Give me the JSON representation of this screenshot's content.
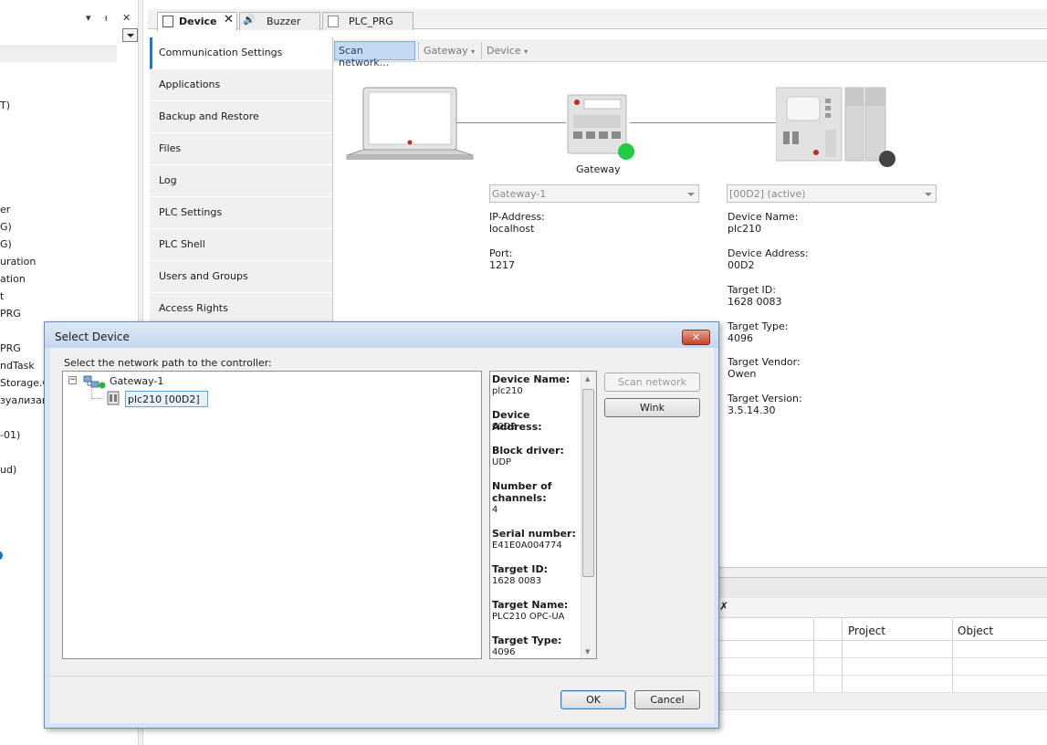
{
  "left_panel": {
    "tree_fragments": [
      "T)",
      "er",
      "G)",
      "G)",
      "uration",
      "ation",
      "t",
      "PRG",
      "PRG",
      "ndTask",
      "Storage.C",
      "зуализац",
      "-01)",
      "ud)"
    ]
  },
  "tabs": [
    {
      "label": "Device",
      "close": "✕"
    },
    {
      "label": "Buzzer"
    },
    {
      "label": "PLC_PRG"
    }
  ],
  "side_menu": {
    "items": [
      "Communication Settings",
      "Applications",
      "Backup and Restore",
      "Files",
      "Log",
      "PLC Settings",
      "PLC Shell",
      "Users and Groups",
      "Access Rights"
    ],
    "active_index": 0
  },
  "toolbar": {
    "scan_network": "Scan network...",
    "gateway_menu": "Gateway",
    "device_menu": "Device"
  },
  "diagram": {
    "gateway_label": "Gateway",
    "gateway_status_color": "#22cc44",
    "device_status_color": "#444444",
    "gateway_combo": "Gateway-1",
    "device_combo": "[00D2] (active)",
    "gateway_info": {
      "ip_label": "IP-Address:",
      "ip_value": "localhost",
      "port_label": "Port:",
      "port_value": "1217"
    },
    "device_info": {
      "name_label": "Device Name:",
      "name_value": "plc210",
      "address_label": "Device Address:",
      "address_value": "00D2",
      "target_id_label": "Target ID:",
      "target_id_value": "1628  0083",
      "target_type_label": "Target Type:",
      "target_type_value": "4096",
      "vendor_label": "Target Vendor:",
      "vendor_value": "Owen",
      "version_label": "Target Version:",
      "version_value": "3.5.14.30"
    }
  },
  "messages": {
    "col_project": "Project",
    "col_object": "Object"
  },
  "dialog": {
    "title": "Select Device",
    "close_label": "✕",
    "prompt": "Select the network path to the controller:",
    "tree": {
      "gateway_node": "Gateway-1",
      "device_node": "plc210 [00D2]"
    },
    "info": [
      {
        "label": "Device Name:",
        "value": "plc210"
      },
      {
        "label": "Device Address:",
        "value": "00D2"
      },
      {
        "label": "Block driver:",
        "value": "UDP"
      },
      {
        "label": "Number of channels:",
        "value": "4"
      },
      {
        "label": "Serial number:",
        "value": "E41E0A004774"
      },
      {
        "label": "Target ID:",
        "value": "1628  0083"
      },
      {
        "label": "Target Name:",
        "value": "PLC210 OPC-UA"
      },
      {
        "label": "Target Type:",
        "value": "4096"
      }
    ],
    "scan_network_button": "Scan network",
    "wink_button": "Wink",
    "ok_button": "OK",
    "cancel_button": "Cancel"
  }
}
